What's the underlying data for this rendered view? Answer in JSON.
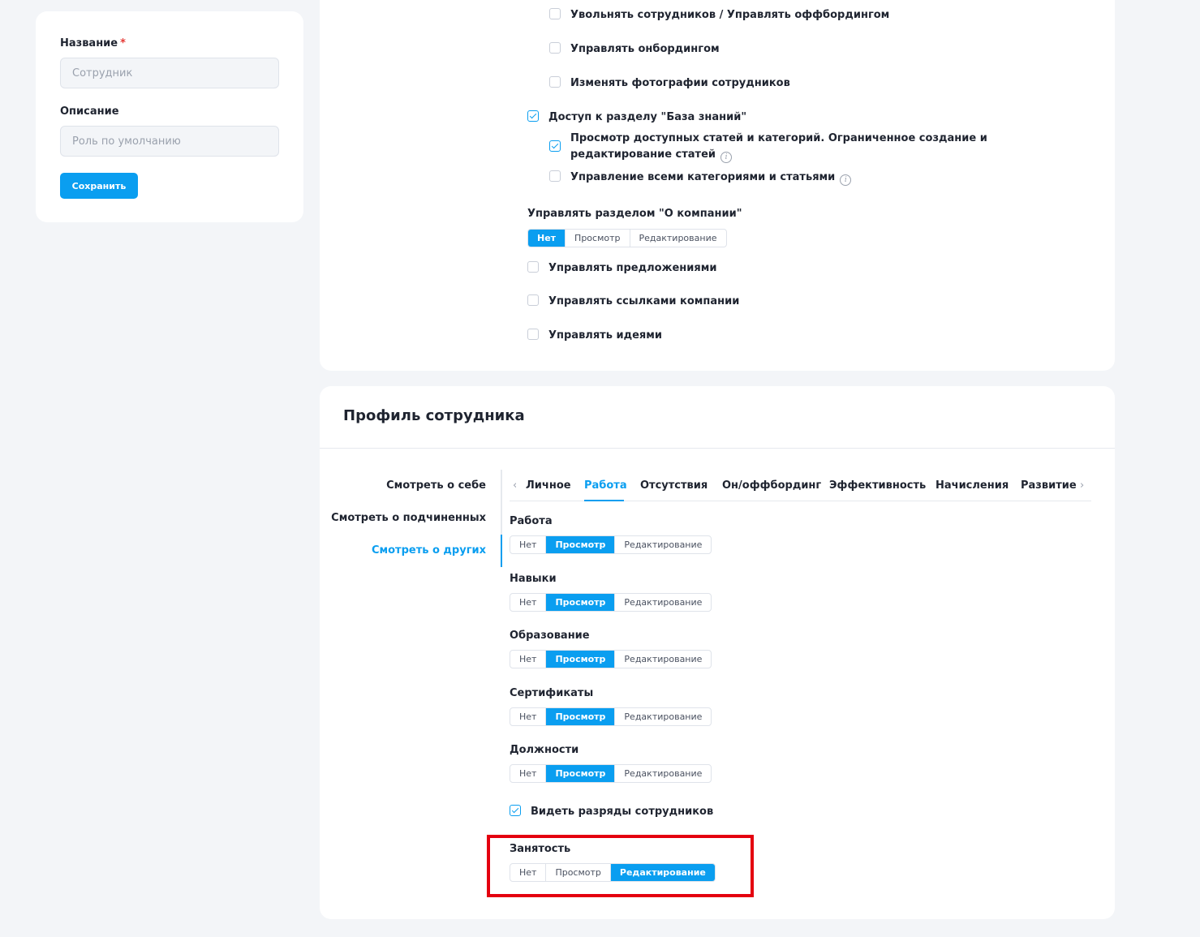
{
  "left_form": {
    "name_label": "Название",
    "name_required": "*",
    "name_placeholder": "Сотрудник",
    "description_label": "Описание",
    "description_placeholder": "Роль по умолчанию",
    "save_label": "Сохранить"
  },
  "permissions": {
    "items": [
      {
        "label": "Увольнять сотрудников / Управлять оффбордингом",
        "checked": false
      },
      {
        "label": "Управлять онбордингом",
        "checked": false
      },
      {
        "label": "Изменять фотографии сотрудников",
        "checked": false
      },
      {
        "label": "Доступ к разделу \"База знаний\"",
        "checked": true
      },
      {
        "label": "Просмотр доступных статей и категорий. Ограниченное создание и редактирование статей",
        "checked": true
      },
      {
        "label": "Управление всеми категориями и статьями",
        "checked": false
      }
    ],
    "about_company_label": "Управлять разделом \"О компании\"",
    "about_company_options": [
      "Нет",
      "Просмотр",
      "Редактирование"
    ],
    "about_company_selected": 0,
    "more_items": [
      {
        "label": "Управлять предложениями",
        "checked": false
      },
      {
        "label": "Управлять ссылками компании",
        "checked": false
      },
      {
        "label": "Управлять идеями",
        "checked": false
      }
    ]
  },
  "profile": {
    "title": "Профиль сотрудника",
    "side_nav": [
      "Смотреть о себе",
      "Смотреть о подчиненных",
      "Смотреть о других"
    ],
    "side_nav_active": 2,
    "tabs": [
      "Личное",
      "Работа",
      "Отсутствия",
      "Он/оффбординг",
      "Эффективность",
      "Начисления",
      "Развитие"
    ],
    "tabs_active": 1,
    "options": [
      "Нет",
      "Просмотр",
      "Редактирование"
    ],
    "sections": [
      {
        "label": "Работа",
        "selected": 1
      },
      {
        "label": "Навыки",
        "selected": 1
      },
      {
        "label": "Образование",
        "selected": 1
      },
      {
        "label": "Сертификаты",
        "selected": 1
      },
      {
        "label": "Должности",
        "selected": 1
      }
    ],
    "grades_checkbox": {
      "label": "Видеть разряды сотрудников",
      "checked": true
    },
    "employment": {
      "label": "Занятость",
      "selected": 2
    }
  },
  "colors": {
    "accent": "#0a9ef0",
    "highlight": "#e4000f"
  },
  "icons": {
    "info": "info-icon",
    "chevron_left": "chevron-left-icon",
    "chevron_right": "chevron-right-icon"
  }
}
